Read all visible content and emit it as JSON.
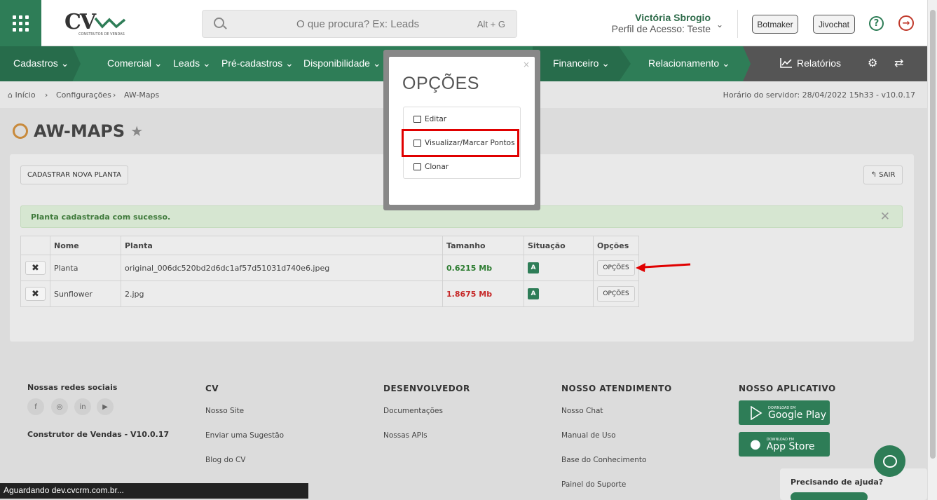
{
  "header": {
    "search_placeholder": "O que procura? Ex: Leads",
    "search_shortcut": "Alt + G",
    "user_name": "Victória Sbrogio",
    "user_profile": "Perfil de Acesso: Teste",
    "botmaker": "Botmaker",
    "jivochat": "Jivochat",
    "logo_text": "CV",
    "logo_sub": "CONSTRUTOR DE VENDAS"
  },
  "nav": {
    "items": [
      "Cadastros",
      "Comercial",
      "Leads",
      "Pré-cadastros",
      "Disponibilidade",
      "Financeiro",
      "Relacionamento"
    ],
    "reports": "Relatórios"
  },
  "breadcrumb": {
    "items": [
      "Início",
      "Configurações",
      "AW-Maps"
    ],
    "server_time": "Horário do servidor: 28/04/2022 15h33 - v10.0.17"
  },
  "page": {
    "title": "AW-MAPS",
    "new_button": "CADASTRAR NOVA PLANTA",
    "exit_button": "SAIR",
    "alert": "Planta cadastrada com sucesso."
  },
  "table": {
    "headers": [
      "Nome",
      "Planta",
      "Tamanho",
      "Situação",
      "Opções"
    ],
    "rows": [
      {
        "nome": "Planta",
        "planta": "original_006dc520bd2d6dc1af57d51031d740e6.jpeg",
        "tamanho": "0.6215 Mb",
        "situacao": "A",
        "opcoes": "OPÇÕES"
      },
      {
        "nome": "Sunflower",
        "planta": "2.jpg",
        "tamanho": "1.8675 Mb",
        "situacao": "A",
        "opcoes": "OPÇÕES"
      }
    ]
  },
  "modal": {
    "title": "OPÇÕES",
    "close": "×",
    "options": [
      "Editar",
      "Visualizar/Marcar Pontos",
      "Clonar"
    ]
  },
  "footer": {
    "social_title": "Nossas redes sociais",
    "version": "Construtor de Vendas - V10.0.17",
    "cv_title": "CV",
    "cv_links": [
      "Nosso Site",
      "Enviar uma Sugestão",
      "Blog do CV"
    ],
    "dev_title": "DESENVOLVEDOR",
    "dev_links": [
      "Documentações",
      "Nossas APIs"
    ],
    "support_title": "NOSSO ATENDIMENTO",
    "support_links": [
      "Nosso Chat",
      "Manual de Uso",
      "Base do Conhecimento",
      "Painel do Suporte"
    ],
    "app_title": "NOSSO APLICATIVO",
    "google_small": "DOWNLOAD EM",
    "google_big": "Google Play",
    "apple_small": "DOWNLOAD EM",
    "apple_big": "App Store",
    "help_text": "Precisando de ajuda?"
  },
  "statusbar": "Aguardando dev.cvcrm.com.br...",
  "colors": {
    "brand": "#2e7d57",
    "danger": "#e00000"
  }
}
